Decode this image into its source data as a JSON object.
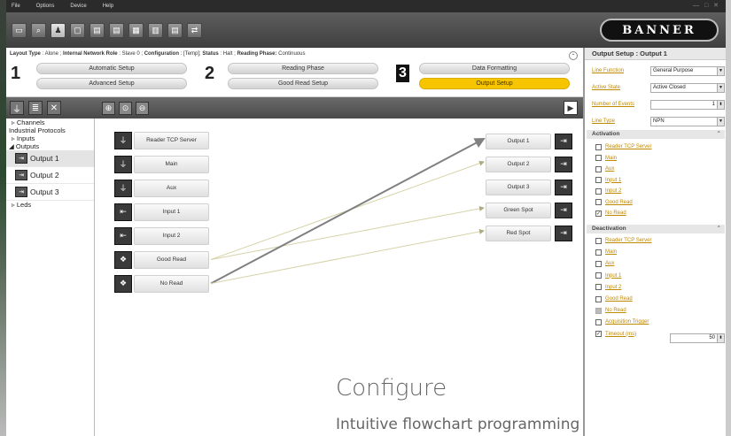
{
  "menu": {
    "items": [
      "File",
      "Options",
      "Device",
      "Help"
    ],
    "window_controls": "— □ ✕"
  },
  "toolbar": {
    "icons": [
      "camera-icon",
      "inspect-icon",
      "user-config-icon",
      "window-icon",
      "monitor-icon",
      "monitor-export-icon",
      "monitor-import-icon",
      "monitor-stats-icon",
      "monitor-send-icon",
      "network-icon"
    ],
    "logo": "BANNER"
  },
  "layout_status": {
    "layout_type_label": "Layout Type",
    "layout_type": "Alone",
    "network_role_label": "Internal Network Role",
    "network_role": "Slave 0",
    "configuration_label": "Configuration",
    "configuration": "[Temp]",
    "status_label": "Status",
    "status": "Halt",
    "reading_phase_label": "Reading Phase:",
    "reading_phase": "Continuous"
  },
  "steps": [
    {
      "number": "1",
      "buttons": [
        "Automatic Setup",
        "Advanced Setup"
      ]
    },
    {
      "number": "2",
      "buttons": [
        "Reading Phase",
        "Good Read Setup"
      ]
    },
    {
      "number": "3",
      "buttons": [
        "Data Formatting",
        "Output Setup"
      ]
    }
  ],
  "selected_step_button": "Output Setup",
  "tree": {
    "items": [
      "Channels",
      "Industrial Protocols",
      "Inputs",
      "Outputs"
    ],
    "outputs": [
      "Output 1",
      "Output 2",
      "Output 3"
    ],
    "last": "Leds",
    "selected": "Output 1"
  },
  "flow": {
    "sources": [
      "Reader TCP Server",
      "Main",
      "Aux",
      "Input 1",
      "Input 2",
      "Good Read",
      "No Read"
    ],
    "targets": [
      "Output 1",
      "Output 2",
      "Output 3",
      "Green Spot",
      "Red Spot"
    ],
    "connections": [
      {
        "from": "Good Read",
        "to": "Output 2"
      },
      {
        "from": "Good Read",
        "to": "Green Spot"
      },
      {
        "from": "No Read",
        "to": "Output 1"
      },
      {
        "from": "No Read",
        "to": "Red Spot"
      }
    ],
    "colors": {
      "strong_wire": "#808080",
      "light_wire": "#d6d2a8"
    }
  },
  "captions": {
    "title": "Configure",
    "subtitle": "Intuitive flowchart programming"
  },
  "right_panel": {
    "title": "Output Setup : Output 1",
    "props": [
      {
        "label": "Line Function",
        "value": "General Purpose",
        "kind": "select"
      },
      {
        "label": "Active State",
        "value": "Active Closed",
        "kind": "select"
      },
      {
        "label": "Number of Events",
        "value": "1",
        "kind": "number"
      },
      {
        "label": "Line Type",
        "value": "NPN",
        "kind": "select"
      }
    ],
    "activation_title": "Activation",
    "activation": [
      {
        "label": "Reader TCP Server",
        "checked": false
      },
      {
        "label": "Main",
        "checked": false
      },
      {
        "label": "Aux",
        "checked": false
      },
      {
        "label": "Input 1",
        "checked": false
      },
      {
        "label": "Input 2",
        "checked": false
      },
      {
        "label": "Good Read",
        "checked": false
      },
      {
        "label": "No Read",
        "checked": true
      }
    ],
    "deactivation_title": "Deactivation",
    "deactivation": [
      {
        "label": "Reader TCP Server",
        "checked": false
      },
      {
        "label": "Main",
        "checked": false
      },
      {
        "label": "Aux",
        "checked": false
      },
      {
        "label": "Input 1",
        "checked": false
      },
      {
        "label": "Input 2",
        "checked": false
      },
      {
        "label": "Good Read",
        "checked": false
      },
      {
        "label": "No Read",
        "checked": false,
        "disabled": true
      },
      {
        "label": "Acquisition Trigger",
        "checked": false
      },
      {
        "label": "Timeout (ms)",
        "checked": true
      }
    ],
    "timeout_value": "50",
    "accent": "#c08a00"
  }
}
